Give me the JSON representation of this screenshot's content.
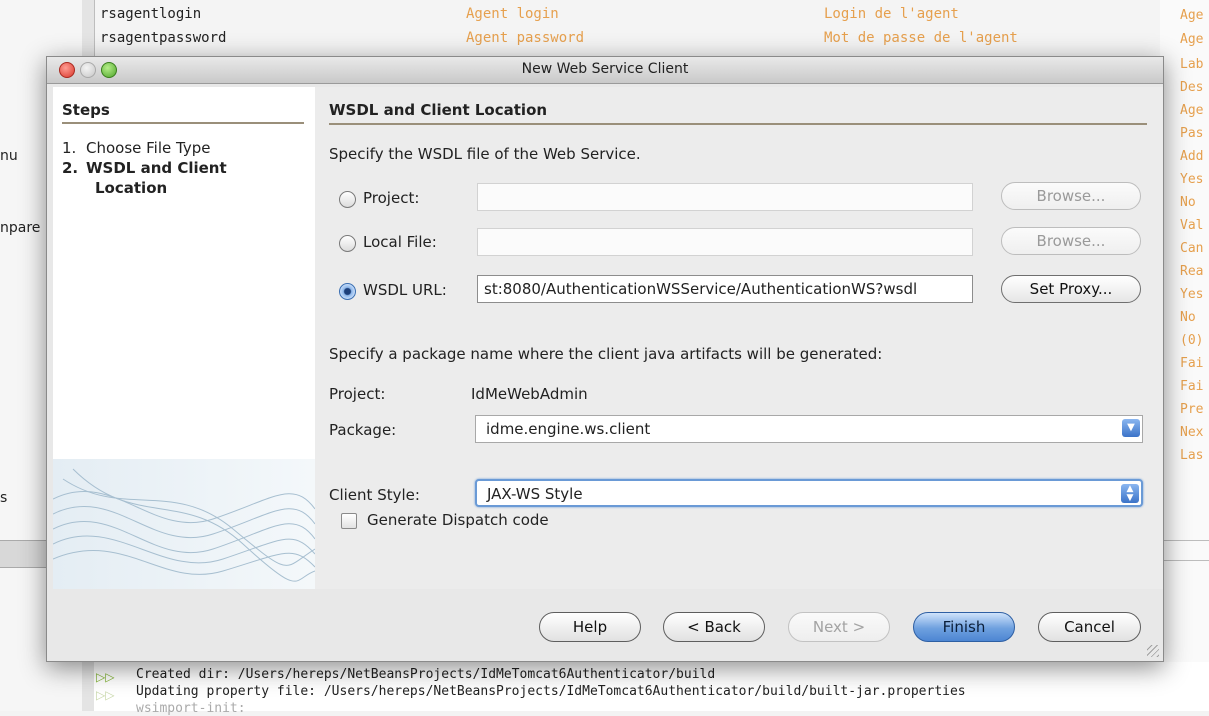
{
  "background": {
    "table_rows": [
      {
        "key": "rsagentlogin",
        "en": "Agent login",
        "fr": "Login de l'agent"
      },
      {
        "key": "rsagentpassword",
        "en": "Agent password",
        "fr": "Mot de passe de l'agent"
      }
    ],
    "right_column": [
      "Age",
      "Age",
      "Lab",
      "Des",
      "Age",
      "Pas",
      "Add",
      "Yes",
      "No ",
      "Val",
      "Can",
      "Rea",
      "Yes",
      "No ",
      "(0)",
      "Fai",
      "Fai",
      "Pre",
      "Nex",
      "Las"
    ],
    "left_fragments": [
      "nu",
      "npare",
      "s"
    ],
    "output_lines": [
      "Created dir: /Users/hereps/NetBeansProjects/IdMeTomcat6Authenticator/build",
      "Updating property file: /Users/hereps/NetBeansProjects/IdMeTomcat6Authenticator/build/built-jar.properties",
      "wsimport-init:"
    ]
  },
  "dialog": {
    "title": "New Web Service Client",
    "steps": {
      "heading": "Steps",
      "items": [
        {
          "num": "1.",
          "label": "Choose File Type"
        },
        {
          "num": "2.",
          "label": "WSDL and Client",
          "cont": "Location"
        }
      ]
    },
    "section_title": "WSDL and Client Location",
    "wsdl_prompt": "Specify the WSDL file of the Web Service.",
    "options": {
      "project_label": "Project:",
      "project_value": "",
      "local_label": "Local File:",
      "local_value": "",
      "url_label": "WSDL URL:",
      "url_value": "st:8080/AuthenticationWSService/AuthenticationWS?wsdl",
      "selected": "WSDL URL"
    },
    "browse_label": "Browse...",
    "set_proxy_label": "Set Proxy...",
    "package_prompt": "Specify a package name where the client java artifacts will be generated:",
    "project_row": {
      "label": "Project:",
      "value": "IdMeWebAdmin"
    },
    "package_row": {
      "label": "Package:",
      "value": "idme.engine.ws.client"
    },
    "client_style": {
      "label": "Client Style:",
      "value": "JAX-WS Style"
    },
    "dispatch_checkbox": {
      "label": "Generate Dispatch code",
      "checked": false
    },
    "buttons": {
      "help": "Help",
      "back": "< Back",
      "next": "Next >",
      "finish": "Finish",
      "cancel": "Cancel"
    },
    "accent": "#4d86d3"
  }
}
